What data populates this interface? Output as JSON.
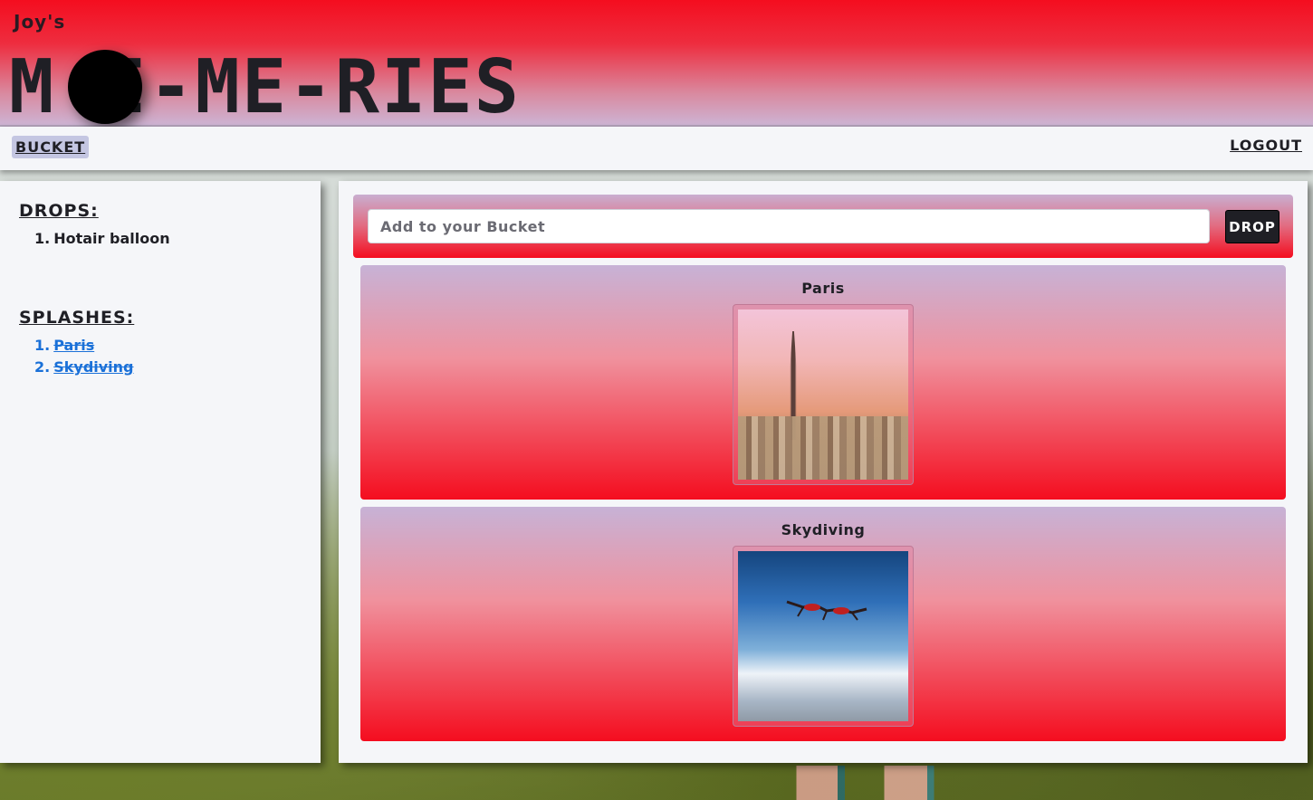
{
  "header": {
    "brand_small": "Joy's",
    "brand_big": "M I-ME-RIES"
  },
  "nav": {
    "bucket_label": "BUCKET",
    "logout_label": "LOGOUT"
  },
  "sidebar": {
    "drops_heading": "DROPS:",
    "drops": [
      {
        "num": "1.",
        "label": "Hotair balloon"
      }
    ],
    "splashes_heading": "SPLASHES:",
    "splashes": [
      {
        "num": "1.",
        "label": "Paris"
      },
      {
        "num": "2.",
        "label": "Skydiving"
      }
    ]
  },
  "main": {
    "input_placeholder": "Add to your Bucket",
    "input_value": "",
    "drop_label": "DROP",
    "cards": [
      {
        "title": "Paris",
        "image": "paris-eiffel-tower-photo"
      },
      {
        "title": "Skydiving",
        "image": "skydivers-in-sky-photo"
      }
    ]
  },
  "colors": {
    "accent_red": "#f40d1f",
    "lavender": "#c9aed0",
    "link_blue": "#1a70d8",
    "dark": "#1f1f25",
    "panel": "#f5f6f9"
  }
}
